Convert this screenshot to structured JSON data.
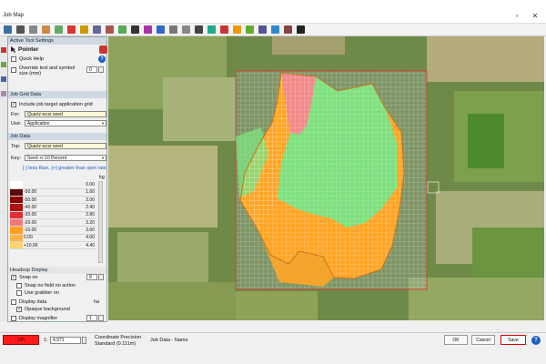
{
  "window": {
    "title": "Job Map",
    "restore_glyph": "▫",
    "close_glyph": "✕"
  },
  "toolbar": {
    "icons": [
      "new-icon",
      "save-icon",
      "print-icon",
      "edit-icon",
      "grid-icon",
      "zoom-icon",
      "layer-icon",
      "erase-icon",
      "measure-icon",
      "image-icon",
      "circle-icon",
      "ring-icon",
      "grid-select-icon",
      "draw-icon",
      "line-icon",
      "hash-icon",
      "target-icon",
      "flag-icon",
      "chart-icon",
      "point-icon",
      "lasso-icon",
      "wave-icon",
      "polygon-icon",
      "pointer-icon"
    ]
  },
  "panel": {
    "active_tool_header": "Active Tool Settings",
    "tool_name": "Pointer",
    "quick_help": "Quick Help",
    "override_label": "Override text and symbol size (mm)",
    "override_value": "0",
    "job_grid_header": "Job Grid Data",
    "include_label": "Include job target application grid",
    "for_label": "For:",
    "for_value": "Quartz wcsr seed",
    "use_label": "Use:",
    "use_value": "Application",
    "job_data_header": "Job Data",
    "top_label": "Top:",
    "top_value": "Quartz wcsr seed",
    "key_label": "Key:",
    "key_value": "Seed +/-10 Percent",
    "hint": "[-] less than, [+] greater than spot rate",
    "unit": "kg",
    "legend": [
      {
        "pct": "",
        "val": "0.00",
        "color": "#ffffff"
      },
      {
        "pct": "-50.00",
        "val": "1.60",
        "color": "#5b0a0a"
      },
      {
        "pct": "-50.00",
        "val": "2.00",
        "color": "#8b0000"
      },
      {
        "pct": "-40.00",
        "val": "2.40",
        "color": "#b01010"
      },
      {
        "pct": "-30.00",
        "val": "2.80",
        "color": "#e03030"
      },
      {
        "pct": "-20.00",
        "val": "3.20",
        "color": "#f07878"
      },
      {
        "pct": "-10.00",
        "val": "3.60",
        "color": "#ff9f1f"
      },
      {
        "pct": "0.00",
        "val": "4.00",
        "color": "#ffb347"
      },
      {
        "pct": "+10.00",
        "val": "4.40",
        "color": "#ffd36b"
      }
    ],
    "headsup_header": "Headsup Display",
    "snap_on": "Snap on",
    "snap_value": "8",
    "snap_no_action": "Snap no field no action",
    "use_grabber": "Use grabber on",
    "display_data": "Display data",
    "display_unit": "ha",
    "opaque_bg": "Opaque background",
    "display_magnifier": "Display magnifier",
    "magnifier_value": "1"
  },
  "statusbar": {
    "color_box": "200",
    "scale_prefix": "1:",
    "scale_value": "4,971",
    "coord_label": "Coordinate Precision",
    "coord_value": "Standard (0.111m)",
    "job_data_name": "Job Data - Name",
    "ok": "OK",
    "cancel": "Cancel",
    "save": "Save",
    "help_glyph": "?"
  },
  "colors": {
    "accent": "#1f5fbf",
    "zone_green": "#7ee07e",
    "zone_orange": "#ffa526",
    "zone_red": "#f28a8a",
    "status_red": "#ff1a1a"
  }
}
